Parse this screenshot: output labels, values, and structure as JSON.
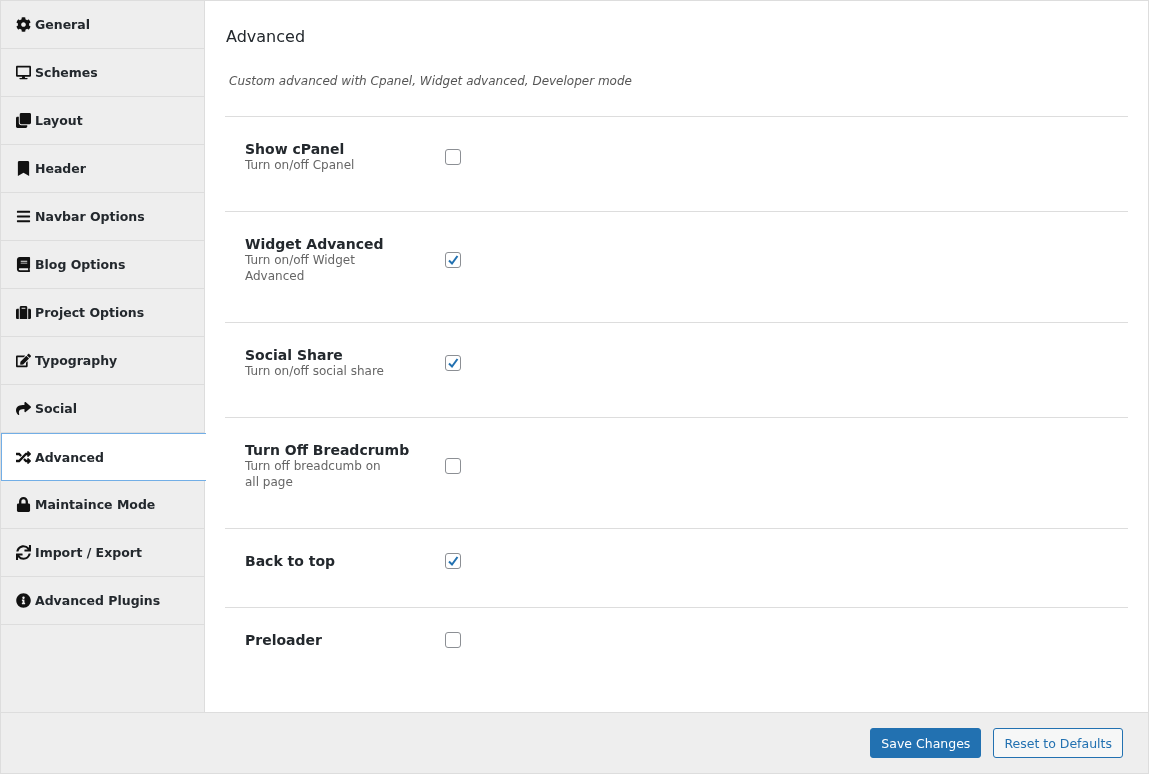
{
  "sidebar": {
    "items": [
      {
        "label": "General",
        "selected": false
      },
      {
        "label": "Schemes",
        "selected": false
      },
      {
        "label": "Layout",
        "selected": false
      },
      {
        "label": "Header",
        "selected": false
      },
      {
        "label": "Navbar Options",
        "selected": false
      },
      {
        "label": "Blog Options",
        "selected": false
      },
      {
        "label": "Project Options",
        "selected": false
      },
      {
        "label": "Typography",
        "selected": false
      },
      {
        "label": "Social",
        "selected": false
      },
      {
        "label": "Advanced",
        "selected": true
      },
      {
        "label": "Maintaince Mode",
        "selected": false
      },
      {
        "label": "Import / Export",
        "selected": false
      },
      {
        "label": "Advanced Plugins",
        "selected": false
      }
    ]
  },
  "section": {
    "title": "Advanced",
    "description": "Custom advanced with Cpanel, Widget advanced, Developer mode"
  },
  "settings": [
    {
      "label": "Show cPanel",
      "hint": "Turn on/off Cpanel",
      "checked": false
    },
    {
      "label": "Widget Advanced",
      "hint": "Turn on/off Widget Advanced",
      "checked": true
    },
    {
      "label": "Social Share",
      "hint": "Turn on/off social share",
      "checked": true
    },
    {
      "label": "Turn Off Breadcrumb",
      "hint": "Turn off breadcumb on all page",
      "checked": false
    },
    {
      "label": "Back to top",
      "checked": true
    },
    {
      "label": "Preloader",
      "checked": false
    }
  ],
  "buttons": {
    "save": "Save Changes",
    "reset": "Reset to Defaults"
  }
}
